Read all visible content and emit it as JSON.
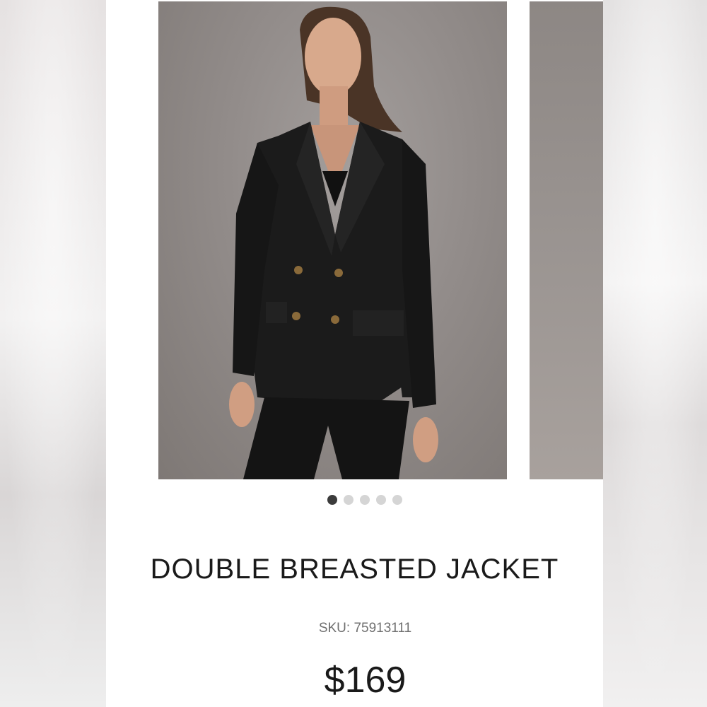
{
  "product": {
    "title": "DOUBLE BREASTED JACKET",
    "sku_label": "SKU: ",
    "sku": "75913111",
    "price": "$169"
  },
  "carousel": {
    "slide_count": 5,
    "active_index": 0
  },
  "colors": {
    "backdrop": "#948e8b",
    "jacket": "#1b1b1b",
    "dot_active": "#3b3b3b",
    "dot_inactive": "#d5d5d5"
  }
}
